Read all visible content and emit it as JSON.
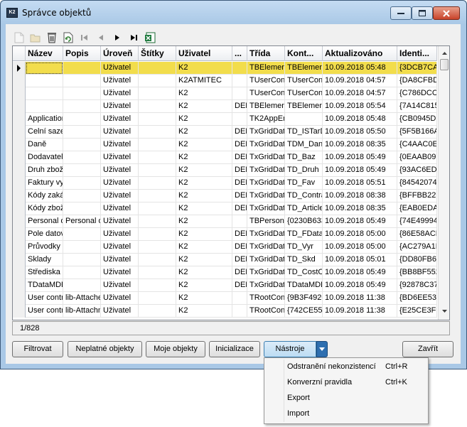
{
  "window": {
    "title": "Správce objektů",
    "app_icon_text": "K2"
  },
  "toolbar": {
    "buttons": [
      {
        "icon": "new-document-icon",
        "enabled": false
      },
      {
        "icon": "open-folder-icon",
        "enabled": false
      },
      {
        "icon": "recycle-icon",
        "enabled": true
      },
      {
        "icon": "refresh-icon",
        "enabled": true
      },
      {
        "icon": "first-record-icon",
        "enabled": false
      },
      {
        "icon": "previous-record-icon",
        "enabled": false
      },
      {
        "icon": "next-record-icon",
        "enabled": true
      },
      {
        "icon": "last-record-icon",
        "enabled": true
      },
      {
        "icon": "excel-export-icon",
        "enabled": true
      }
    ]
  },
  "grid": {
    "columns": [
      "Název",
      "Popis",
      "Úroveň",
      "Štítky",
      "Uživatel",
      "...",
      "Třída",
      "Kont...",
      "Aktualizováno",
      "Identi..."
    ],
    "rows": [
      [
        "",
        "",
        "Uživatel",
        "",
        "K2",
        "",
        "TBElement",
        "TBElement",
        "10.09.2018 05:48",
        "{3DCB7CA6"
      ],
      [
        "",
        "",
        "Uživatel",
        "",
        "K2ATMITEC",
        "",
        "TUserConf",
        "TUserConf",
        "10.09.2018 04:57",
        "{DA8CFBD"
      ],
      [
        "",
        "",
        "Uživatel",
        "",
        "K2",
        "",
        "TUserConf",
        "TUserConf",
        "10.09.2018 04:57",
        "{C786DCCI"
      ],
      [
        "",
        "",
        "Uživatel",
        "",
        "K2",
        "DEM",
        "TBElement",
        "TBElement",
        "10.09.2018 05:54",
        "{7A14C815"
      ],
      [
        "Application",
        "",
        "Uživatel",
        "",
        "K2",
        "",
        "TK2AppEnv",
        "",
        "10.09.2018 05:48",
        "{CB0945DE"
      ],
      [
        "Celní sazeb",
        "",
        "Uživatel",
        "",
        "K2",
        "DEM",
        "TxGridData",
        "TD_ISTarD",
        "10.09.2018 05:50",
        "{5F5B166A"
      ],
      [
        "Daně",
        "",
        "Uživatel",
        "",
        "K2",
        "DEM",
        "TxGridData",
        "TDM_Dane",
        "10.09.2018 08:35",
        "{C4AAC0E0"
      ],
      [
        "Dodavatelé",
        "",
        "Uživatel",
        "",
        "K2",
        "DEM",
        "TxGridData",
        "TD_Baz",
        "10.09.2018 05:49",
        "{0EAAB097"
      ],
      [
        "Druh zboží",
        "",
        "Uživatel",
        "",
        "K2",
        "DEM",
        "TxGridData",
        "TD_Druh",
        "10.09.2018 05:49",
        "{93AC6EDI"
      ],
      [
        "Faktury vy",
        "",
        "Uživatel",
        "",
        "K2",
        "DEM",
        "TxGridData",
        "TD_Fav",
        "10.09.2018 05:51",
        "{84542074"
      ],
      [
        "Kódy zakáz",
        "",
        "Uživatel",
        "",
        "K2",
        "DEM",
        "TxGridData",
        "TD_Contra",
        "10.09.2018 08:38",
        "{BFFBB22B"
      ],
      [
        "Kódy zboží",
        "",
        "Uživatel",
        "",
        "K2",
        "DEM",
        "TxGridData",
        "TD_Article",
        "10.09.2018 08:35",
        "{EAB0EDA"
      ],
      [
        "Personal d",
        "Personal d",
        "Uživatel",
        "",
        "K2",
        "",
        "TBPersona",
        "{0230B633",
        "10.09.2018 05:49",
        "{74E49994"
      ],
      [
        "Pole datov",
        "",
        "Uživatel",
        "",
        "K2",
        "DEM",
        "TxGridData",
        "TD_FDataM",
        "10.09.2018 05:00",
        "{86E58ACE"
      ],
      [
        "Průvodky",
        "",
        "Uživatel",
        "",
        "K2",
        "DEM",
        "TxGridData",
        "TD_Vyr",
        "10.09.2018 05:00",
        "{AC279A1E"
      ],
      [
        "Sklady",
        "",
        "Uživatel",
        "",
        "K2",
        "DEM",
        "TxGridData",
        "TD_Skd",
        "10.09.2018 05:01",
        "{DD80FB6A"
      ],
      [
        "Střediska",
        "",
        "Uživatel",
        "",
        "K2",
        "DEM",
        "TxGridData",
        "TD_CostCe",
        "10.09.2018 05:49",
        "{BB8BF552"
      ],
      [
        "TDataMDD",
        "",
        "Uživatel",
        "",
        "K2",
        "DEM",
        "TxGridData",
        "TDataMDD",
        "10.09.2018 05:49",
        "{92878C37"
      ],
      [
        "User contr",
        "lib-Attache",
        "Uživatel",
        "",
        "K2",
        "",
        "TRootConf",
        "{9B3F4920",
        "10.09.2018 11:38",
        "{BD6EE537"
      ],
      [
        "User contr",
        "lib-Attachm",
        "Uživatel",
        "",
        "K2",
        "",
        "TRootConf",
        "{742CE559",
        "10.09.2018 11:38",
        "{E25CE3F9"
      ]
    ],
    "selected_row": 0,
    "highlight_color": "#f2dd4c"
  },
  "status": {
    "record_position": "1/828"
  },
  "buttons": {
    "filter": "Filtrovat",
    "invalid_objects": "Neplatné objekty",
    "my_objects": "Moje objekty",
    "initialize": "Inicializace",
    "tools": "Nástroje",
    "close": "Zavřít"
  },
  "tools_menu": {
    "items": [
      {
        "label": "Odstranění nekonzistencí",
        "shortcut": "Ctrl+R"
      },
      {
        "label": "Konverzní pravidla",
        "shortcut": "Ctrl+K"
      },
      {
        "label": "Export",
        "shortcut": ""
      },
      {
        "label": "Import",
        "shortcut": ""
      }
    ]
  }
}
